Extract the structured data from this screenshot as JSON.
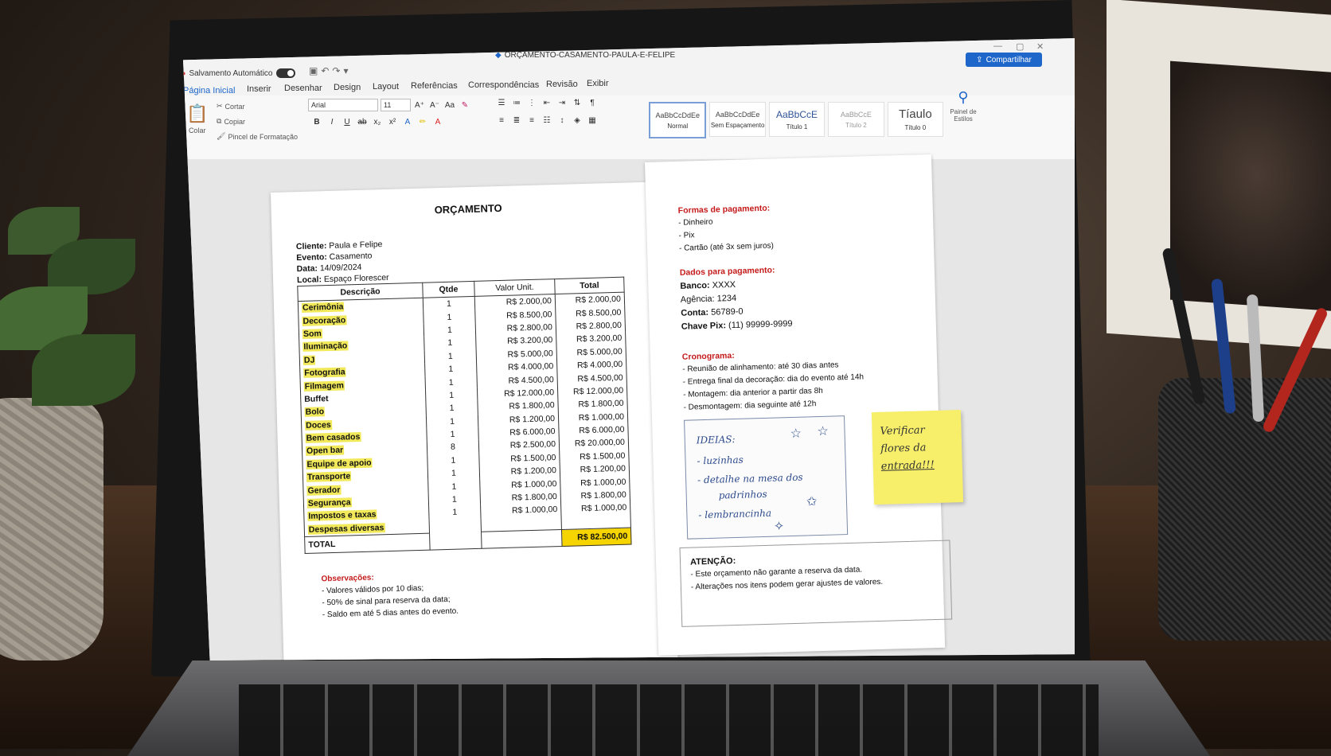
{
  "window": {
    "autosave_label": "Salvamento Automático",
    "doc_title": "ORÇAMENTO-CASAMENTO-PAULA-E-FELIPE",
    "share_label": "Compartilhar"
  },
  "ribbon": {
    "tabs": [
      "Página Inicial",
      "Inserir",
      "Desenhar",
      "Design",
      "Layout",
      "Referências",
      "Correspondências",
      "Revisão",
      "Exibir"
    ],
    "clipboard": {
      "paste": "Colar",
      "cut": "Cortar",
      "copy": "Copiar",
      "format_painter": "Pincel de Formatação"
    },
    "font_name": "Arial",
    "font_size": "11",
    "styles": [
      {
        "preview": "AaBbCcDdEe",
        "name": "Normal"
      },
      {
        "preview": "AaBbCcDdEe",
        "name": "Sem Espaçamento"
      },
      {
        "preview": "AaBbCcE",
        "name": "Título 1"
      },
      {
        "preview": "AaBbCcE",
        "name": "Título 2"
      },
      {
        "preview": "Tíaulo",
        "name": "Título 0"
      }
    ],
    "styles_pane": "Painel de Estilos"
  },
  "doc": {
    "title": "ORÇAMENTO",
    "meta": [
      {
        "label": "Cliente:",
        "value": "Paula e Felipe"
      },
      {
        "label": "Evento:",
        "value": "Casamento"
      },
      {
        "label": "Data:",
        "value": "14/09/2024"
      },
      {
        "label": "Local:",
        "value": "Espaço Florescer"
      }
    ],
    "table_headers": {
      "item": "Descrição",
      "qty": "Qtde",
      "unit": "Valor Unit.",
      "total": "Total"
    },
    "items": [
      {
        "name": "Cerimônia",
        "qty": "1",
        "unit": "R$ 2.000,00",
        "total": "R$ 2.000,00"
      },
      {
        "name": "Decoração",
        "qty": "1",
        "unit": "R$ 8.500,00",
        "total": "R$ 8.500,00"
      },
      {
        "name": "Som",
        "qty": "1",
        "unit": "R$ 2.800,00",
        "total": "R$ 2.800,00"
      },
      {
        "name": "Iluminação",
        "qty": "1",
        "unit": "R$ 3.200,00",
        "total": "R$ 3.200,00"
      },
      {
        "name": "DJ",
        "qty": "1",
        "unit": "R$ 5.000,00",
        "total": "R$ 5.000,00"
      },
      {
        "name": "Fotografia",
        "qty": "1",
        "unit": "R$ 4.000,00",
        "total": "R$ 4.000,00"
      },
      {
        "name": "Filmagem",
        "qty": "1",
        "unit": "R$ 4.500,00",
        "total": "R$ 4.500,00"
      },
      {
        "name": "Buffet",
        "qty": "1",
        "unit": "R$ 12.000,00",
        "total": "R$ 12.000,00"
      },
      {
        "name": "Bolo",
        "qty": "1",
        "unit": "R$ 1.800,00",
        "total": "R$ 1.800,00"
      },
      {
        "name": "Doces",
        "qty": "1",
        "unit": "R$ 1.200,00",
        "total": "R$ 1.000,00"
      },
      {
        "name": "Bem casados",
        "qty": "1",
        "unit": "R$ 6.000,00",
        "total": "R$ 6.000,00"
      },
      {
        "name": "Open bar",
        "qty": "8",
        "unit": "R$ 2.500,00",
        "total": "R$ 20.000,00"
      },
      {
        "name": "Equipe de apoio",
        "qty": "1",
        "unit": "R$ 1.500,00",
        "total": "R$ 1.500,00"
      },
      {
        "name": "Transporte",
        "qty": "1",
        "unit": "R$ 1.200,00",
        "total": "R$ 1.200,00"
      },
      {
        "name": "Gerador",
        "qty": "1",
        "unit": "R$ 1.000,00",
        "total": "R$ 1.000,00"
      },
      {
        "name": "Segurança",
        "qty": "1",
        "unit": "R$ 1.800,00",
        "total": "R$ 1.800,00"
      },
      {
        "name": "Impostos e taxas",
        "qty": "1",
        "unit": "R$ 1.000,00",
        "total": "R$ 1.000,00"
      },
      {
        "name": "Despesas diversas",
        "qty": "",
        "unit": "",
        "total": ""
      }
    ],
    "total_label": "TOTAL",
    "grand_total": "R$ 82.500,00",
    "observations_title": "Observações:",
    "observations": [
      "- Valores válidos por 10 dias;",
      "- 50% de sinal para reserva da data;",
      "- Saldo em até 5 dias antes do evento."
    ]
  },
  "right": {
    "payment_title": "Formas de pagamento:",
    "payment_methods": [
      "- Dinheiro",
      "- Pix",
      "- Cartão (até 3x sem juros)"
    ],
    "bank_title": "Dados para pagamento:",
    "bank": [
      {
        "label": "Banco:",
        "value": "XXXX"
      },
      {
        "label": "Agência:",
        "value": "1234"
      },
      {
        "label": "Conta:",
        "value": "56789-0"
      },
      {
        "label": "Chave Pix:",
        "value": "(11) 99999-9999"
      }
    ],
    "schedule_title": "Cronograma:",
    "schedule": [
      "- Reunião de alinhamento: até 30 dias antes",
      "- Entrega final da decoração: dia do evento até 14h",
      "- Montagem: dia anterior a partir das 8h",
      "- Desmontagem: dia seguinte até 12h"
    ],
    "ideas": {
      "title": "IDEIAS:",
      "lines": [
        "- luzinhas",
        "- detalhe na mesa dos",
        "padrinhos",
        "- lembrancinha"
      ]
    },
    "sticky_note": [
      "Verificar",
      "flores da",
      "entrada!!!"
    ],
    "attention_title": "ATENÇÃO:",
    "attention": [
      "- Este orçamento não garante a reserva da data.",
      "- Alterações nos itens podem gerar ajustes de valores."
    ]
  }
}
